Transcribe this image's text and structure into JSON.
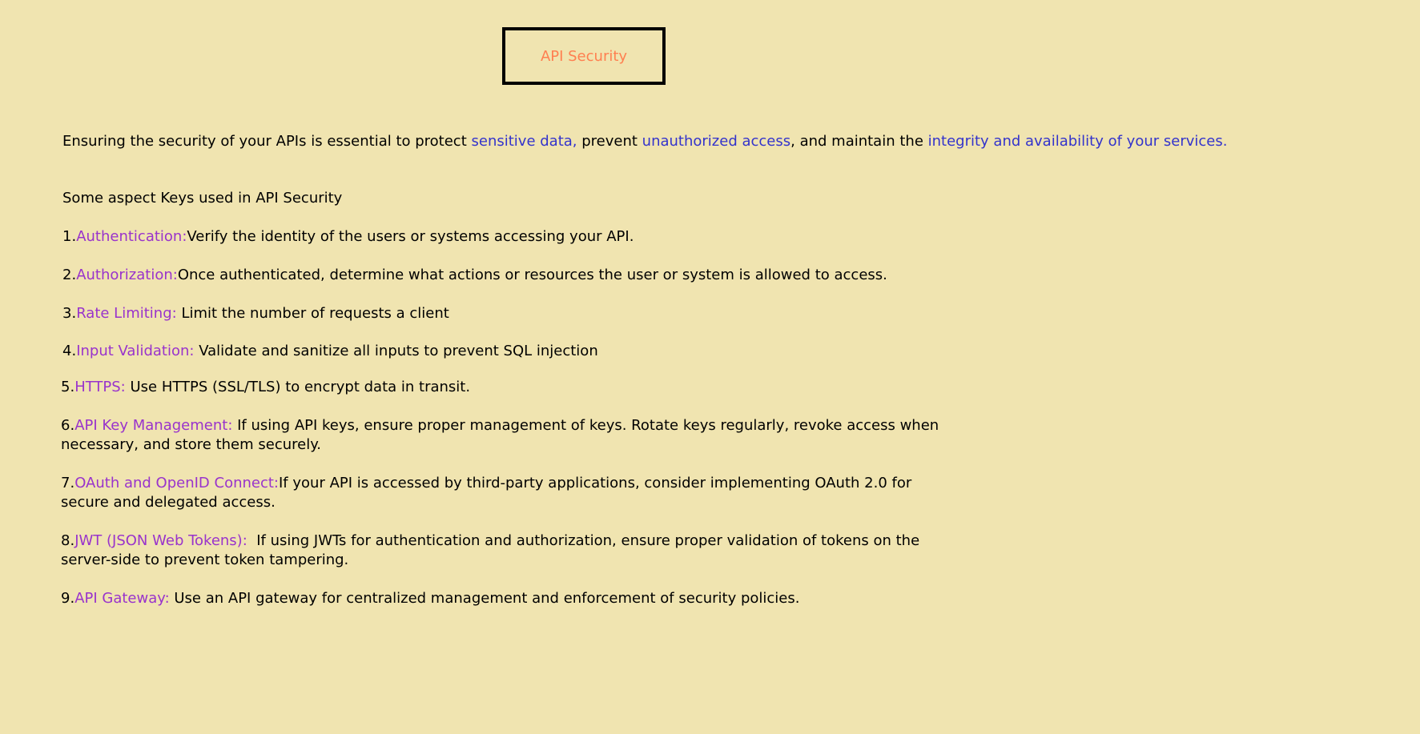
{
  "title": "API Security",
  "intro": {
    "t1": "Ensuring the security of your APIs is essential to protect ",
    "h1": "sensitive data,",
    "t2": " prevent ",
    "h2": "unauthorized access",
    "t3": ", and maintain the ",
    "h3": "integrity and availability of your services."
  },
  "subheading": "Some aspect Keys used in API Security",
  "items": [
    {
      "num": "1.",
      "term": "Authentication:",
      "desc": "Verify the identity of the users or systems accessing your API."
    },
    {
      "num": "2.",
      "term": "Authorization:",
      "desc": "Once authenticated, determine what actions or resources the user or system is allowed to access."
    },
    {
      "num": "3.",
      "term": "Rate Limiting:",
      "desc": " Limit the number of requests a client"
    },
    {
      "num": "4.",
      "term": "Input Validation:",
      "desc": " Validate and sanitize all inputs to prevent SQL injection"
    },
    {
      "num": "5.",
      "term": "HTTPS:",
      "desc": " Use HTTPS (SSL/TLS) to encrypt data in transit."
    },
    {
      "num": "6.",
      "term": "API Key Management:",
      "desc": " If using API keys, ensure proper management of keys. Rotate keys regularly, revoke access when",
      "desc2": "necessary, and store them securely."
    },
    {
      "num": "7.",
      "term": "OAuth and OpenID Connect:",
      "desc": "If your API is accessed by third-party applications, consider implementing OAuth 2.0 for",
      "desc2": "secure and delegated access."
    },
    {
      "num": "8.",
      "term": "JWT (JSON Web Tokens):",
      "desc": "  If using JWTs for authentication and authorization, ensure proper validation of tokens on the",
      "desc2": "server-side to prevent token tampering."
    },
    {
      "num": "9.",
      "term": "API Gateway:",
      "desc": " Use an API gateway for centralized management and enforcement of security policies."
    }
  ],
  "colors": {
    "background": "#f0e4b0",
    "title": "#ff7f50",
    "highlight_blue": "#3333cc",
    "highlight_purple": "#9933cc"
  }
}
